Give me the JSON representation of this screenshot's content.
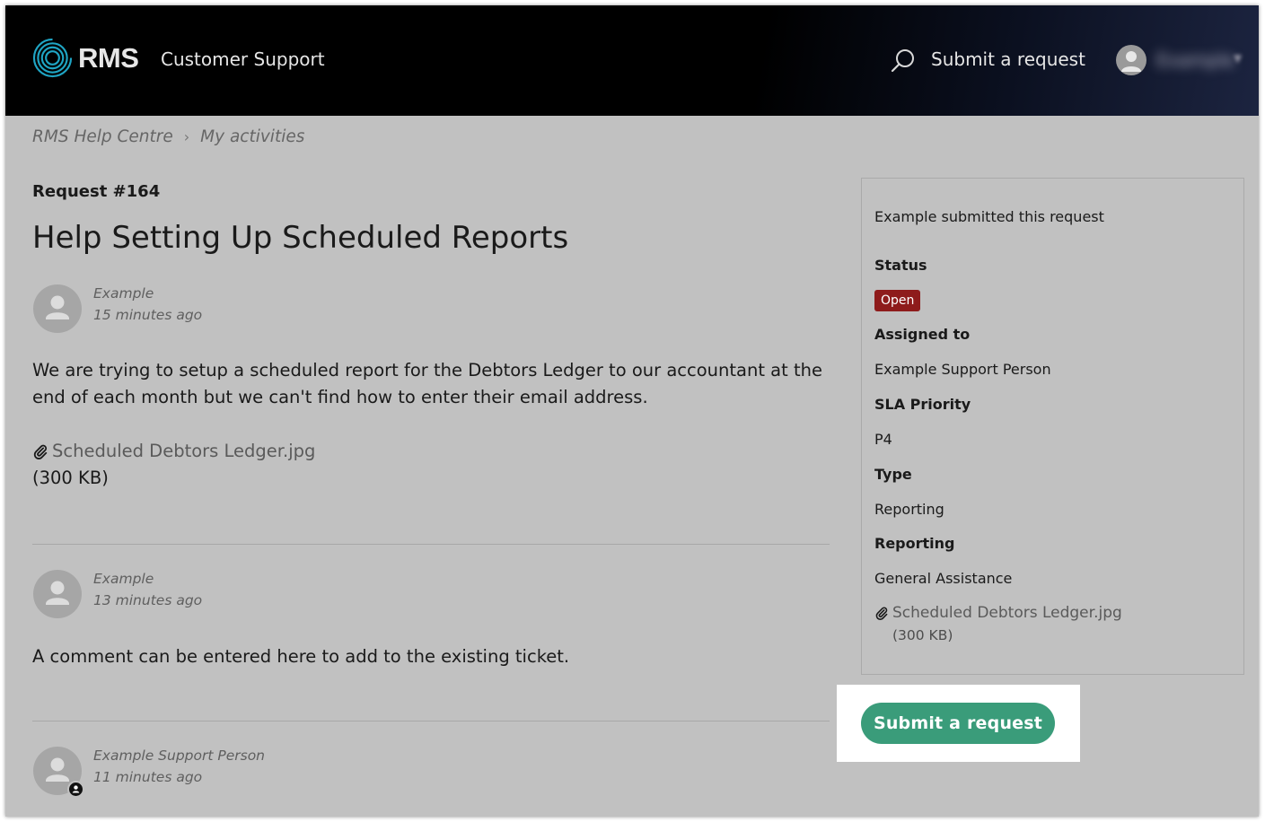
{
  "header": {
    "logo_text": "RMS",
    "title": "Customer Support",
    "submit_link": "Submit a request",
    "user_name": "Example"
  },
  "breadcrumb": [
    "RMS Help Centre",
    "My activities"
  ],
  "request": {
    "number": "Request #164",
    "title": "Help Setting Up Scheduled Reports"
  },
  "comments": [
    {
      "author": "Example",
      "time": "15 minutes ago",
      "body": "We are trying to setup a scheduled report for the Debtors Ledger to our accountant at the end of each month but we can't find how to enter their email address.",
      "attachment_name": "Scheduled Debtors Ledger.jpg",
      "attachment_size": "(300 KB)"
    },
    {
      "author": "Example",
      "time": "13 minutes ago",
      "body": "A comment can be entered here to add to the existing ticket."
    },
    {
      "author": "Example Support Person",
      "time": "11 minutes ago"
    }
  ],
  "sidebar": {
    "submitted": "Example submitted this request",
    "status_label": "Status",
    "status_value": "Open",
    "status_color": "#8e1b1b",
    "assigned_label": "Assigned to",
    "assigned_value": "Example Support Person",
    "sla_label": "SLA Priority",
    "sla_value": "P4",
    "type_label": "Type",
    "type_value": "Reporting",
    "reporting_label": "Reporting",
    "reporting_value": "General Assistance",
    "attachment_name": "Scheduled Debtors Ledger.jpg",
    "attachment_size": "(300 KB)"
  },
  "submit_button": "Submit a request",
  "colors": {
    "accent": "#3a9c7a",
    "logo": "#1fa5c4"
  }
}
